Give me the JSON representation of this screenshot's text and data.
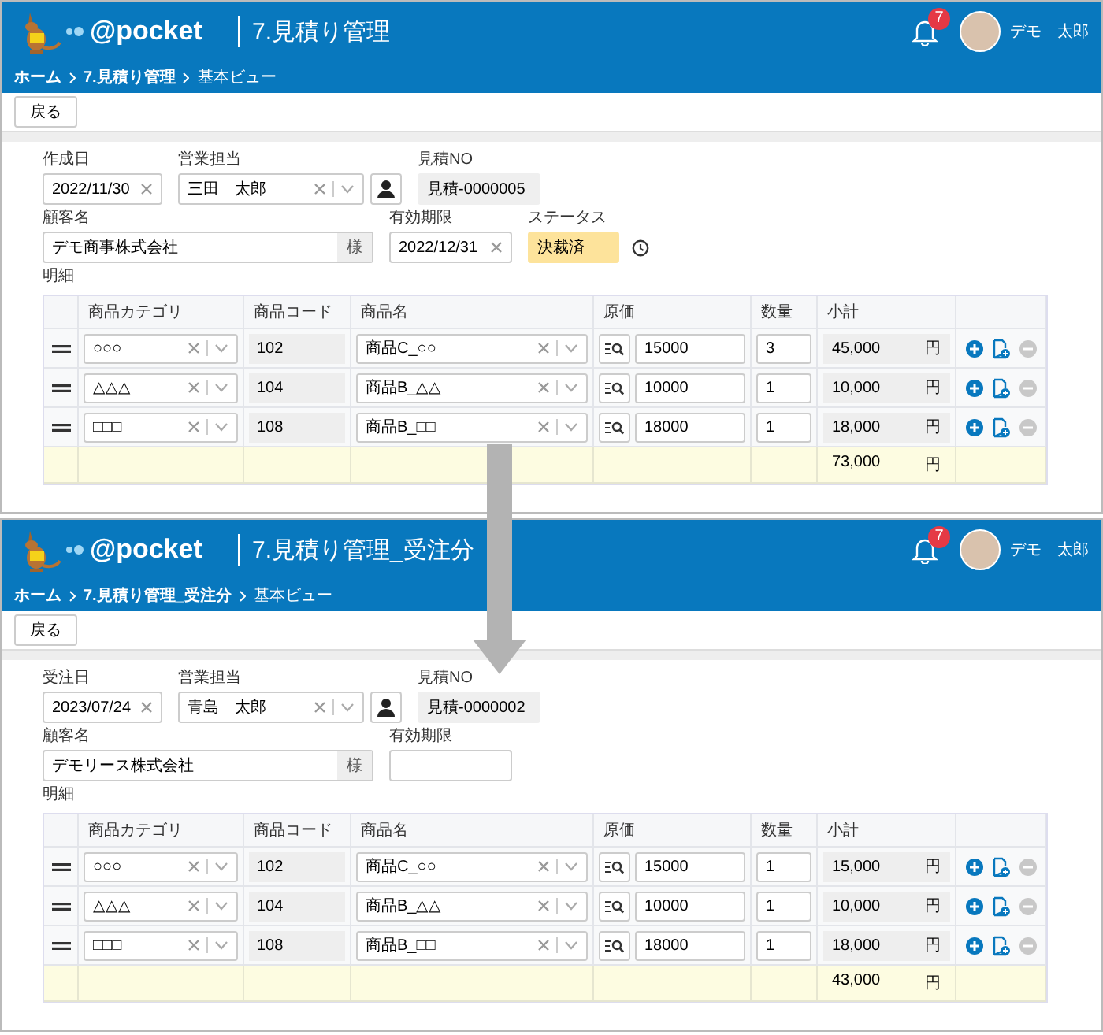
{
  "screens": [
    {
      "header": {
        "logo": "@pocket",
        "title": "7.見積り管理",
        "notification_count": "7",
        "user_name": "デモ　太郎",
        "breadcrumb": [
          "ホーム",
          "7.見積り管理",
          "基本ビュー"
        ]
      },
      "toolbar": {
        "back_button": "戻る"
      },
      "form": {
        "date": {
          "label": "作成日",
          "value": "2022/11/30"
        },
        "sales_rep": {
          "label": "営業担当",
          "value": "三田　太郎"
        },
        "quote_no": {
          "label": "見積NO",
          "value": "見積-0000005"
        },
        "customer": {
          "label": "顧客名",
          "value": "デモ商事株式会社",
          "suffix": "様"
        },
        "expiry": {
          "label": "有効期限",
          "value": "2022/12/31"
        },
        "status": {
          "label": "ステータス",
          "value": "決裁済"
        }
      },
      "details": {
        "label": "明細",
        "columns": [
          "商品カテゴリ",
          "商品コード",
          "商品名",
          "原価",
          "数量",
          "小計"
        ],
        "rows": [
          {
            "category": "○○○",
            "code": "102",
            "name": "商品C_○○",
            "price": "15000",
            "quantity": "3",
            "subtotal": "45,000",
            "unit": "円",
            "remove_disabled": true
          },
          {
            "category": "△△△",
            "code": "104",
            "name": "商品B_△△",
            "price": "10000",
            "quantity": "1",
            "subtotal": "10,000",
            "unit": "円",
            "remove_disabled": true
          },
          {
            "category": "□□□",
            "code": "108",
            "name": "商品B_□□",
            "price": "18000",
            "quantity": "1",
            "subtotal": "18,000",
            "unit": "円",
            "remove_disabled": true
          }
        ],
        "total": {
          "subtotal": "73,000",
          "unit": "円"
        }
      }
    },
    {
      "header": {
        "logo": "@pocket",
        "title": "7.見積り管理_受注分",
        "notification_count": "7",
        "user_name": "デモ　太郎",
        "breadcrumb": [
          "ホーム",
          "7.見積り管理_受注分",
          "基本ビュー"
        ]
      },
      "toolbar": {
        "back_button": "戻る"
      },
      "form": {
        "date": {
          "label": "受注日",
          "value": "2023/07/24"
        },
        "sales_rep": {
          "label": "営業担当",
          "value": "青島　太郎"
        },
        "quote_no": {
          "label": "見積NO",
          "value": "見積-0000002"
        },
        "customer": {
          "label": "顧客名",
          "value": "デモリース株式会社",
          "suffix": "様"
        },
        "expiry": {
          "label": "有効期限"
        }
      },
      "details": {
        "label": "明細",
        "columns": [
          "商品カテゴリ",
          "商品コード",
          "商品名",
          "原価",
          "数量",
          "小計"
        ],
        "rows": [
          {
            "category": "○○○",
            "code": "102",
            "name": "商品C_○○",
            "price": "15000",
            "quantity": "1",
            "subtotal": "15,000",
            "unit": "円",
            "remove_disabled": true
          },
          {
            "category": "△△△",
            "code": "104",
            "name": "商品B_△△",
            "price": "10000",
            "quantity": "1",
            "subtotal": "10,000",
            "unit": "円",
            "remove_disabled": true
          },
          {
            "category": "□□□",
            "code": "108",
            "name": "商品B_□□",
            "price": "18000",
            "quantity": "1",
            "subtotal": "18,000",
            "unit": "円",
            "remove_disabled": true
          }
        ],
        "total": {
          "subtotal": "43,000",
          "unit": "円"
        }
      }
    }
  ]
}
